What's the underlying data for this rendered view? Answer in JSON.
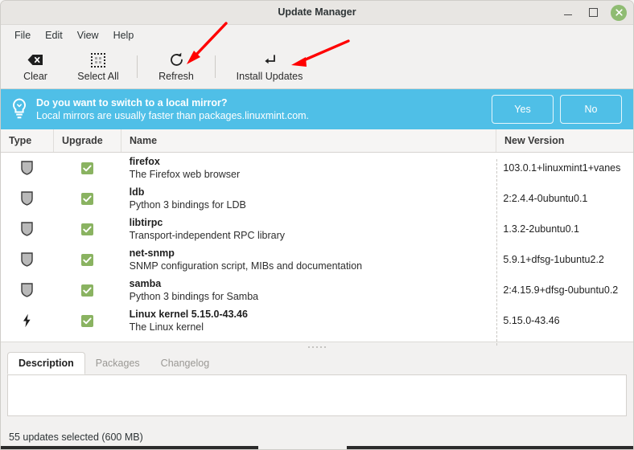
{
  "window": {
    "title": "Update Manager",
    "controls": {
      "minimize": "minimize-icon",
      "maximize": "maximize-icon",
      "close": "close-icon"
    }
  },
  "menubar": {
    "items": [
      {
        "label": "File"
      },
      {
        "label": "Edit"
      },
      {
        "label": "View"
      },
      {
        "label": "Help"
      }
    ]
  },
  "toolbar": {
    "buttons": [
      {
        "label": "Clear",
        "icon": "clear-icon"
      },
      {
        "label": "Select All",
        "icon": "select-all-icon"
      },
      {
        "label": "Refresh",
        "icon": "refresh-icon"
      },
      {
        "label": "Install Updates",
        "icon": "install-updates-icon"
      }
    ]
  },
  "annotations": {
    "arrows": [
      {
        "name": "arrow-pointing-refresh",
        "color": "#ff0000"
      },
      {
        "name": "arrow-pointing-install-updates",
        "color": "#ff0000"
      }
    ]
  },
  "banner": {
    "icon": "lightbulb-icon",
    "title": "Do you want to switch to a local mirror?",
    "subtitle": "Local mirrors are usually faster than packages.linuxmint.com.",
    "yes_label": "Yes",
    "no_label": "No",
    "background_color": "#4fbfe7"
  },
  "table": {
    "columns": [
      "Type",
      "Upgrade",
      "Name",
      "New Version"
    ],
    "rows": [
      {
        "type_icon": "shield-icon",
        "checked": true,
        "name": "firefox",
        "description": "The Firefox web browser",
        "new_version": "103.0.1+linuxmint1+vanes"
      },
      {
        "type_icon": "shield-icon",
        "checked": true,
        "name": "ldb",
        "description": "Python 3 bindings for LDB",
        "new_version": "2:2.4.4-0ubuntu0.1"
      },
      {
        "type_icon": "shield-icon",
        "checked": true,
        "name": "libtirpc",
        "description": "Transport-independent RPC library",
        "new_version": "1.3.2-2ubuntu0.1"
      },
      {
        "type_icon": "shield-icon",
        "checked": true,
        "name": "net-snmp",
        "description": "SNMP configuration script, MIBs and documentation",
        "new_version": "5.9.1+dfsg-1ubuntu2.2"
      },
      {
        "type_icon": "shield-icon",
        "checked": true,
        "name": "samba",
        "description": "Python 3 bindings for Samba",
        "new_version": "2:4.15.9+dfsg-0ubuntu0.2"
      },
      {
        "type_icon": "kernel-bolt-icon",
        "checked": true,
        "name": "Linux kernel 5.15.0-43.46",
        "description": "The Linux kernel",
        "new_version": "5.15.0-43.46"
      }
    ]
  },
  "detail_tabs": {
    "items": [
      {
        "label": "Description",
        "active": true
      },
      {
        "label": "Packages",
        "active": false
      },
      {
        "label": "Changelog",
        "active": false
      }
    ]
  },
  "statusbar": {
    "text": "55 updates selected (600 MB)"
  },
  "colors": {
    "accent_blue": "#4fbfe7",
    "check_green": "#8ab361",
    "close_green": "#8fbc72",
    "arrow_red": "#ff0000"
  }
}
